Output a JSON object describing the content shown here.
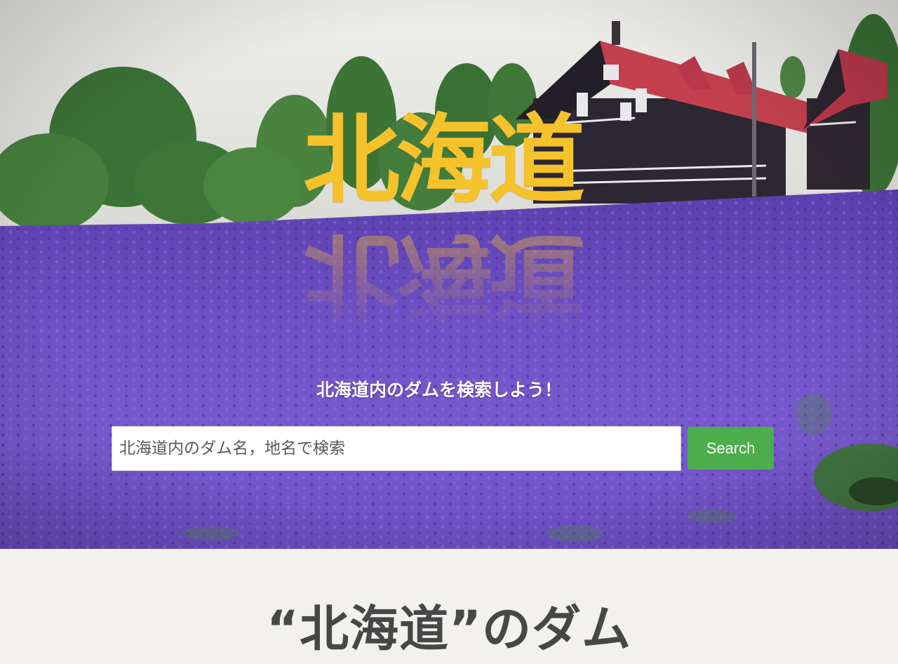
{
  "hero": {
    "title": "北海道",
    "reflection": "北海道",
    "tagline": "北海道内のダムを検索しよう！",
    "colors": {
      "title": "#f4c22b",
      "lavender": "#7a5dc0",
      "sky": "#dcdcd8"
    }
  },
  "search": {
    "placeholder": "北海道内のダム名，地名で検索",
    "value": "",
    "button_label": "Search",
    "button_color": "#4cae4c"
  },
  "section": {
    "heading": "“北海道”のダム"
  }
}
